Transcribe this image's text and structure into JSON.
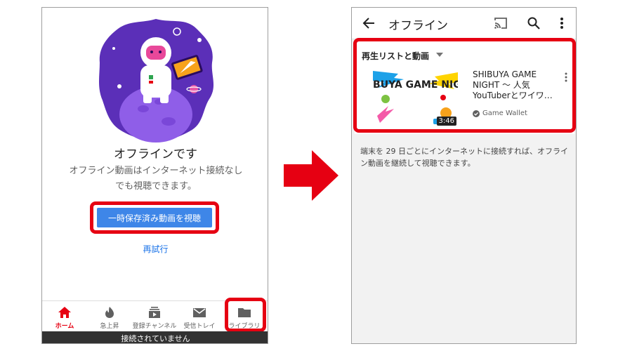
{
  "left_screen": {
    "offline_title": "オフラインです",
    "offline_message": "オフライン動画はインターネット接続なしでも視聴できます。",
    "watch_button_label": "一時保存済み動画を視聴",
    "retry_label": "再試行",
    "nav": [
      {
        "label": "ホーム",
        "icon": "home-icon",
        "active": true
      },
      {
        "label": "急上昇",
        "icon": "flame-icon",
        "active": false
      },
      {
        "label": "登録チャンネル",
        "icon": "subscriptions-icon",
        "active": false
      },
      {
        "label": "受信トレイ",
        "icon": "mail-icon",
        "active": false
      },
      {
        "label": "ライブラリ",
        "icon": "folder-icon",
        "active": false
      }
    ],
    "status_bar": "接続されていません"
  },
  "right_screen": {
    "title": "オフライン",
    "section_title": "再生リストと動画",
    "video": {
      "thumbnail_text": "SHIBUYA GAME NIGHT",
      "duration": "3:46",
      "title": "SHIBUYA GAME NIGHT ～ 人気YouTuberとワイワ…",
      "channel": "Game Wallet"
    },
    "note": "端末を 29 日ごとにインターネットに接続すれば、オフライン動画を継続して視聴できます。"
  },
  "colors": {
    "highlight": "#e60012",
    "button": "#3e86e8",
    "active_nav": "#e60012",
    "link": "#1a73e8",
    "status_bg": "#323232"
  }
}
